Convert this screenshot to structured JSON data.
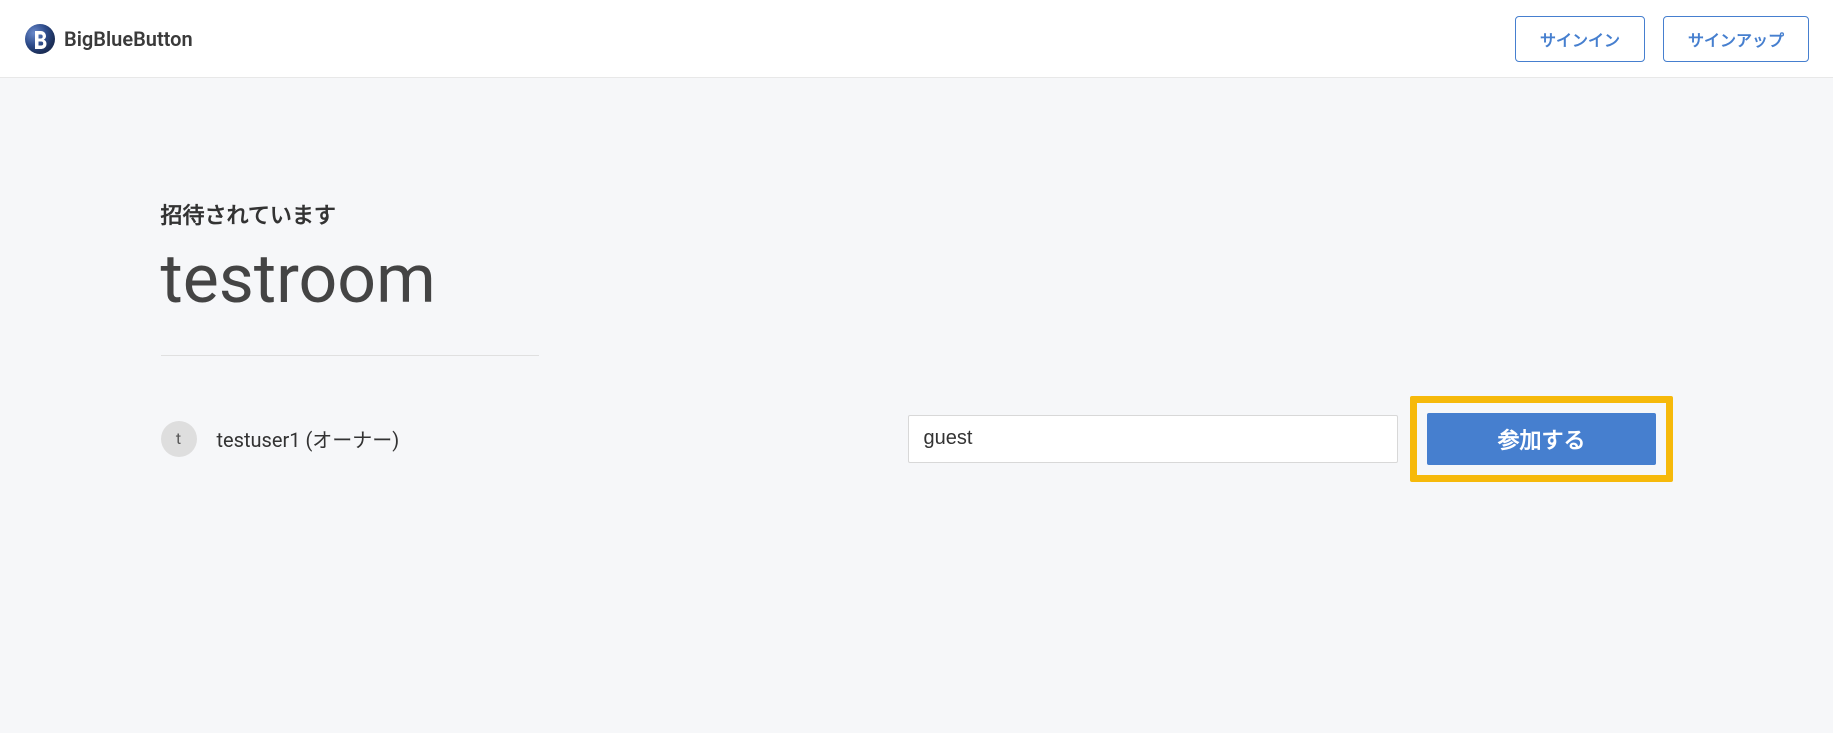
{
  "header": {
    "logo_text": "BigBlueButton",
    "signin_label": "サインイン",
    "signup_label": "サインアップ"
  },
  "main": {
    "invite_label": "招待されています",
    "room_name": "testroom",
    "owner": {
      "avatar_initial": "t",
      "label": "testuser1 (オーナー)"
    },
    "join": {
      "name_value": "guest",
      "button_label": "参加する"
    }
  }
}
